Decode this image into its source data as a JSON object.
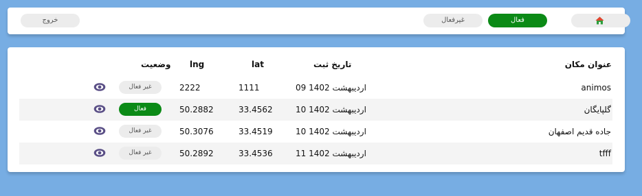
{
  "nav": {
    "home_icon": "home-icon",
    "active_label": "فعال",
    "inactive_label": "غیرفعال",
    "logout_label": "خروج"
  },
  "table": {
    "headers": {
      "title": "عنوان مکان",
      "date": "تاریخ ثبت",
      "lat": "lat",
      "lng": "lng",
      "status": "وضعیت"
    },
    "rows": [
      {
        "title": "animos",
        "date": "09 اردیبهشت 1402",
        "lat": "1111",
        "lng": "2222",
        "status": "غیر فعال",
        "active": false
      },
      {
        "title": "گلپایگان",
        "date": "10 اردیبهشت 1402",
        "lat": "33.4562",
        "lng": "50.2882",
        "status": "فعال",
        "active": true
      },
      {
        "title": "جاده قدیم اصفهان",
        "date": "10 اردیبهشت 1402",
        "lat": "33.4519",
        "lng": "50.3076",
        "status": "غیر فعال",
        "active": false
      },
      {
        "title": "tfff",
        "date": "11 اردیبهشت 1402",
        "lat": "33.4536",
        "lng": "50.2892",
        "status": "غیر فعال",
        "active": false
      }
    ],
    "view_icon": "eye-icon"
  },
  "colors": {
    "background": "#77ade3",
    "active_green": "#0b8a16",
    "inactive_gray": "#ececec",
    "eye_purple": "#5a4f86"
  }
}
